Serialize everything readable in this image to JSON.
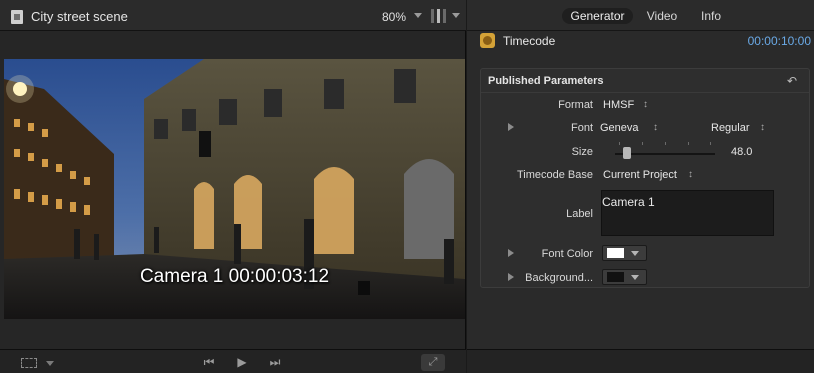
{
  "viewer": {
    "clip_title": "City street scene",
    "zoom": "80%",
    "burned_timecode": "Camera 1 00:00:03:12",
    "transport": {
      "prev_glyph": "⏮",
      "play_glyph": "▶",
      "next_glyph": "⏭",
      "fullscreen_glyph": "⤢"
    }
  },
  "inspector": {
    "tabs": [
      {
        "label": "Generator",
        "active": true
      },
      {
        "label": "Video",
        "active": false
      },
      {
        "label": "Info",
        "active": false
      }
    ],
    "generator_name": "Timecode",
    "duration": "00:00:10:00",
    "published_parameters": {
      "title": "Published Parameters",
      "reset_glyph": "↶",
      "format_label": "Format",
      "format_value": "HMSF",
      "font_label": "Font",
      "font_family_value": "Geneva",
      "font_style_value": "Regular",
      "size_label": "Size",
      "size_value": "48.0",
      "size_level": 0.12,
      "timecode_base_label": "Timecode Base",
      "timecode_base_value": "Current Project",
      "label_label": "Label",
      "label_value": "Camera 1",
      "font_color_label": "Font Color",
      "font_color_value": "#ffffff",
      "background_label": "Background...",
      "background_value": "#111111",
      "updown_glyph": "↕"
    }
  },
  "colors": {
    "accent_timecode": "#6aa9e6",
    "panel_bg": "#2e2e2e",
    "generator_icon": "#d4a237"
  },
  "icons": [
    "clip-icon",
    "view-switch-icon",
    "crop-icon",
    "generator-icon",
    "reset-icon",
    "fullscreen-icon"
  ]
}
